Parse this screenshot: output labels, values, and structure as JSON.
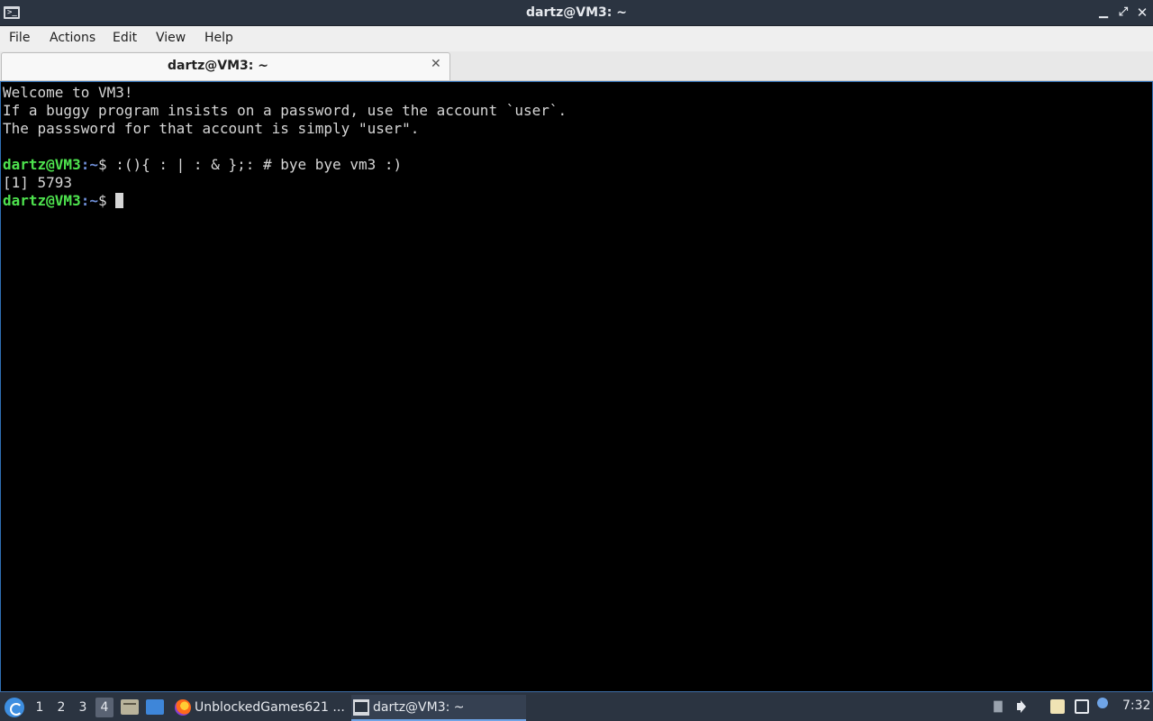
{
  "window": {
    "title": "dartz@VM3: ~",
    "app_icon_glyph": ">_",
    "minimize_glyph": "▁",
    "maximize_glyph": "⤢",
    "close_glyph": "✕"
  },
  "menubar": {
    "file": "File",
    "actions": "Actions",
    "edit": "Edit",
    "view": "View",
    "help": "Help"
  },
  "tab": {
    "label": "dartz@VM3: ~",
    "close_glyph": "✕"
  },
  "terminal": {
    "lines": [
      "Welcome to VM3!",
      "If a buggy program insists on a password, use the account `user`.",
      "The passsword for that account is simply \"user\".",
      ""
    ],
    "prompt_user": "dartz@VM3",
    "prompt_path": ":~",
    "prompt_symbol": "$ ",
    "command_1": ":(){ : | : & };: # bye bye vm3 :)",
    "output_1": "[1] 5793",
    "colors": {
      "background": "#000000",
      "text": "#d6d6d6",
      "prompt_user": "#4ee34e",
      "prompt_path": "#6f8fd8"
    }
  },
  "taskbar": {
    "workspaces": [
      "1",
      "2",
      "3",
      "4"
    ],
    "active_workspace": "4",
    "tasks": [
      {
        "label": "UnblockedGames621 ...",
        "icon": "firefox-icon"
      },
      {
        "label": "dartz@VM3: ~",
        "icon": "terminal-icon"
      }
    ],
    "clock": "7:32"
  }
}
